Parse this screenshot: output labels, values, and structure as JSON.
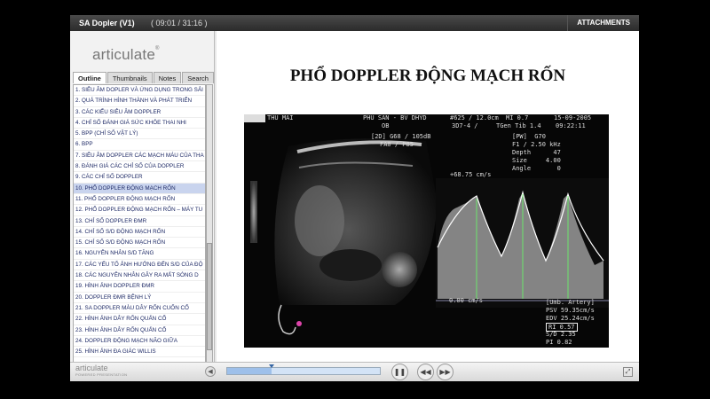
{
  "titlebar": {
    "title": "SA Dopler (V1)",
    "time": "( 09:01 / 31:16 )",
    "attachments": "ATTACHMENTS"
  },
  "sidebar": {
    "logo": "articulate",
    "tabs": [
      {
        "label": "Outline"
      },
      {
        "label": "Thumbnails"
      },
      {
        "label": "Notes"
      },
      {
        "label": "Search"
      }
    ],
    "outline": [
      "1. SIÊU ÂM DOPLER VÀ ỨNG DỤNG TRONG SẢI",
      "2. QUÁ TRÌNH HÌNH THÀNH VÀ PHÁT TRIỂN",
      "3. CÁC KIỂU SIÊU ÂM DOPPLER",
      "4. CHỈ SỐ ĐÁNH GIÁ SỨC KHỎE THAI NHI",
      "5. BPP (CHỈ SỐ VẬT LÝ)",
      "6. BPP",
      "7. SIÊU ÂM DOPPLER CÁC MẠCH MÁU CỦA THA",
      "8. ĐÁNH GIÁ CÁC CHỈ SỐ CỦA DOPPLER",
      "9. CÁC CHỈ SỐ DOPPLER",
      "10. PHỔ DOPPLER ĐỘNG MẠCH RỐN",
      "11. PHỔ DOPPLER ĐỘNG MẠCH RỐN",
      "12. PHỔ DOPPLER ĐỘNG MẠCH RỐN – MÁY TU",
      "13. CHỈ SỐ DOPPLER ĐMR",
      "14. CHỈ SỐ S/D ĐỘNG MẠCH RỐN",
      "15. CHỈ SỐ S/D ĐỘNG MẠCH RỐN",
      "16. NGUYÊN NHÂN S/D TĂNG",
      "17. CÁC YẾU TỐ ẢNH HƯỞNG ĐẾN S/D CỦA ĐỘ",
      "18. CÁC NGUYÊN NHÂN GÂY RA MẤT SÓNG D",
      "19. HÌNH ẢNH DOPPLER ĐMR",
      "20. DOPPLER ĐMR BỆNH LÝ",
      "21. SA DOPPLER MÀU DÂY RỐN CUỐN CỔ",
      "22. HÌNH ẢNH DÂY RỐN QUẤN CỔ",
      "23. HÌNH ẢNH DÂY RỐN QUẤN CỔ",
      "24. DOPPLER ĐỘNG MẠCH NÃO GIỮA",
      "25. HÌNH ẢNH ĐA GIÁC WILLIS"
    ],
    "selected_index": 9
  },
  "slide": {
    "title": "PHỔ DOPPLER ĐỘNG MẠCH RỐN",
    "us": {
      "name": "THU MAI",
      "hospital": "PHU SAN - BV DHYD",
      "dept": "OB",
      "probe": "#625",
      "depth_top": "/ 12.0cm",
      "mi": "MI 0.7",
      "date": "15-09-2005",
      "mode": "3D7-4 /",
      "tgen": "TGen Tib 1.4",
      "clock": "09:22:11",
      "gain1": "[2D] G68 / 105dB",
      "gain2": "FA0 / P85",
      "pw": "[PW]  G70",
      "freq": "F1 / 2.50 kHz",
      "depth": "Depth      47",
      "size": "Size     4.00",
      "angle": "Angle       0",
      "vel": "+68.75 cm/s",
      "zero": "0.00 cm/s",
      "meas_title": "[Umb. Artery]",
      "psv": "PSV 59.35cm/s",
      "edv": "EDV 25.24cm/s",
      "ri": "RI 0.57",
      "sd": "S/D 2.35",
      "pi": "PI 0.82"
    }
  },
  "bottombar": {
    "logo": "articulate",
    "logo_sub": "POWERED PRESENTATION",
    "progress": 0.288
  }
}
